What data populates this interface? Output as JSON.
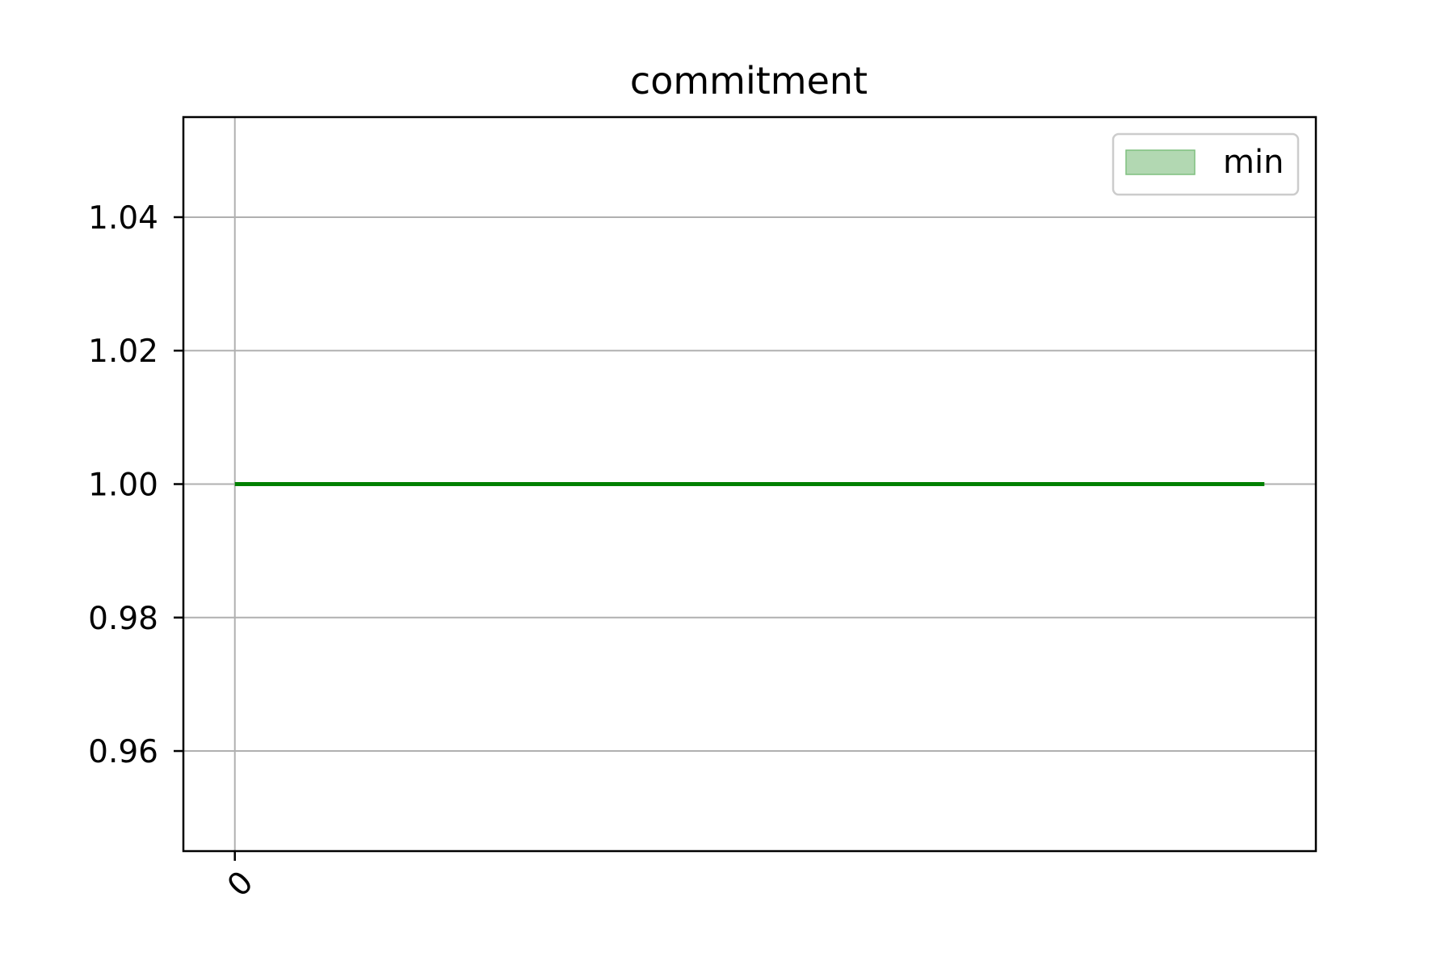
{
  "chart_data": {
    "type": "line",
    "title": "commitment",
    "xlabel": "",
    "ylabel": "",
    "x_ticks": [
      "0"
    ],
    "x_range": [
      -0.05,
      1.05
    ],
    "y_ticks": [
      "0.96",
      "0.98",
      "1.00",
      "1.02",
      "1.04"
    ],
    "ylim": [
      0.945,
      1.055
    ],
    "grid": true,
    "legend_position": "top-right",
    "series": [
      {
        "name": "min",
        "color": "#008000",
        "legend_swatch_color": "#b2d8b2",
        "x": [
          0,
          1
        ],
        "y": [
          1.0,
          1.0
        ]
      }
    ]
  }
}
